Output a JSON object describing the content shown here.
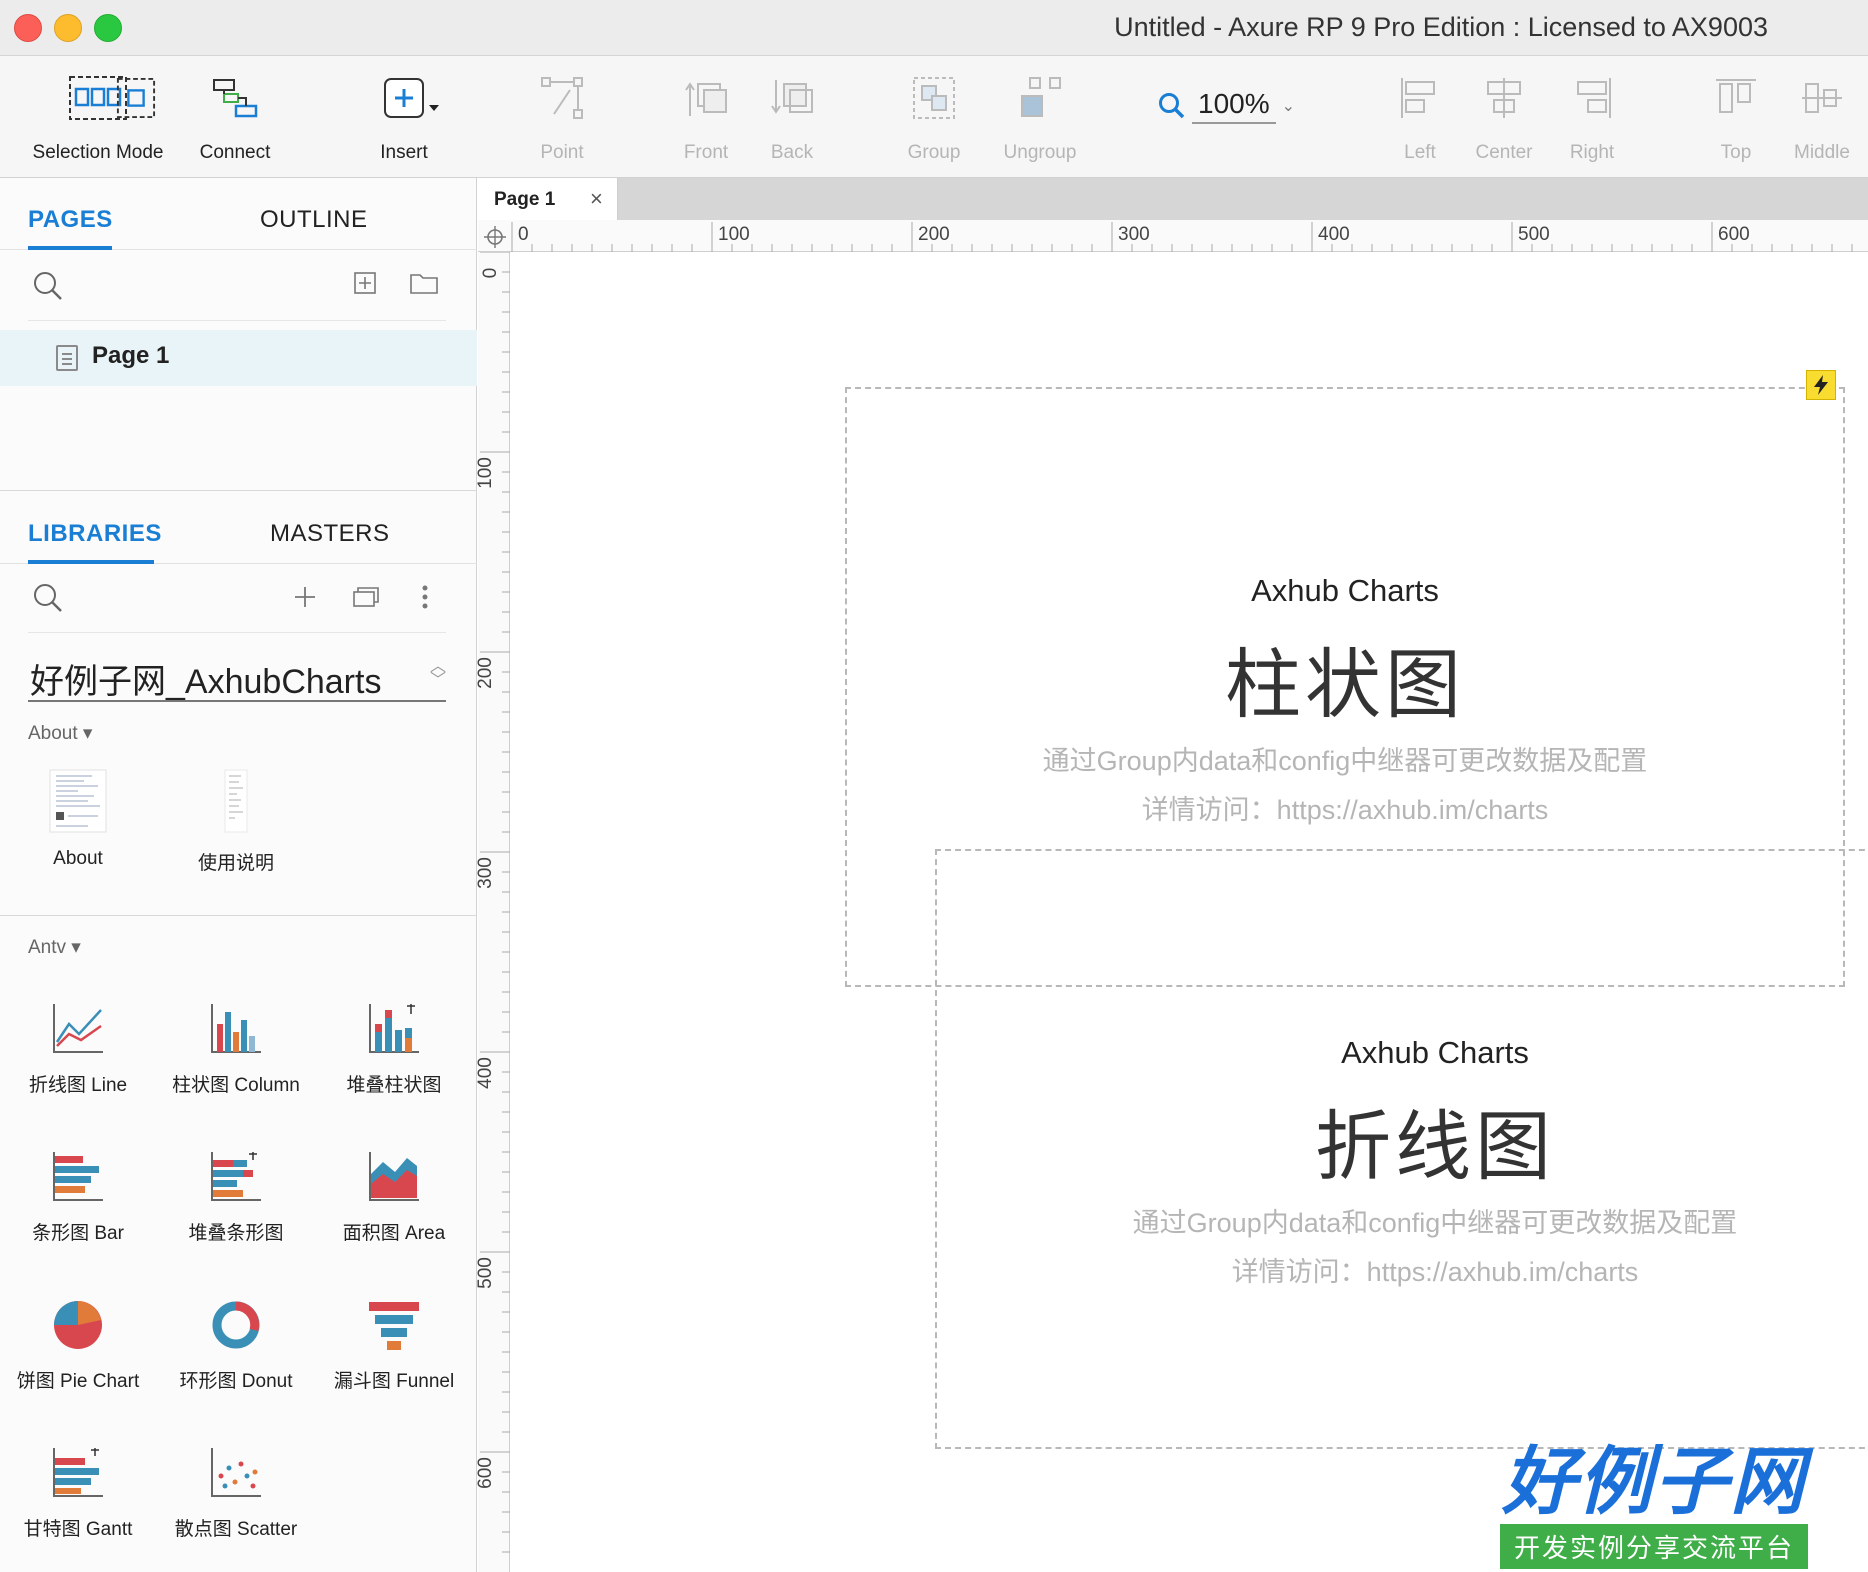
{
  "window": {
    "title": "Untitled - Axure RP 9 Pro Edition : Licensed to AX9003"
  },
  "toolbar": {
    "selection_mode": "Selection Mode",
    "connect": "Connect",
    "insert": "Insert",
    "point": "Point",
    "front": "Front",
    "back": "Back",
    "group": "Group",
    "ungroup": "Ungroup",
    "zoom": "100%",
    "left": "Left",
    "center": "Center",
    "right": "Right",
    "top": "Top",
    "middle": "Middle"
  },
  "pages_panel": {
    "tab_pages": "PAGES",
    "tab_outline": "OUTLINE",
    "items": [
      {
        "label": "Page 1"
      }
    ]
  },
  "libraries_panel": {
    "tab_libraries": "LIBRARIES",
    "tab_masters": "MASTERS",
    "selected_library": "好例子网_AxhubCharts",
    "section_about": "About ▾",
    "about_items": [
      {
        "label": "About"
      },
      {
        "label": "使用说明"
      }
    ],
    "section_antv": "Antv ▾",
    "antv_items": [
      {
        "label": "折线图 Line"
      },
      {
        "label": "柱状图 Column"
      },
      {
        "label": "堆叠柱状图"
      },
      {
        "label": "条形图 Bar"
      },
      {
        "label": "堆叠条形图"
      },
      {
        "label": "面积图 Area"
      },
      {
        "label": "饼图 Pie Chart"
      },
      {
        "label": "环形图 Donut"
      },
      {
        "label": "漏斗图 Funnel"
      },
      {
        "label": "甘特图 Gantt"
      },
      {
        "label": "散点图 Scatter"
      }
    ]
  },
  "canvas": {
    "page_tab": "Page 1",
    "page_tab_close": "×",
    "hruler": [
      "0",
      "100",
      "200",
      "300",
      "400",
      "500",
      "600"
    ],
    "vruler": [
      "0",
      "100",
      "200",
      "300",
      "400",
      "500",
      "600"
    ],
    "card1": {
      "title": "Axhub Charts",
      "name": "柱状图",
      "desc": "通过Group内data和config中继器可更改数据及配置",
      "link": "详情访问：https://axhub.im/charts"
    },
    "card2": {
      "title": "Axhub Charts",
      "name": "折线图",
      "desc": "通过Group内data和config中继器可更改数据及配置",
      "link": "详情访问：https://axhub.im/charts"
    }
  },
  "watermark_logo": {
    "main": "好例子网",
    "sub": "开发实例分享交流平台"
  },
  "colors": {
    "accent": "#1a7fd4",
    "selection": "#e8f4f8",
    "logo_blue": "#1a6fd9",
    "logo_green": "#3fae49"
  }
}
